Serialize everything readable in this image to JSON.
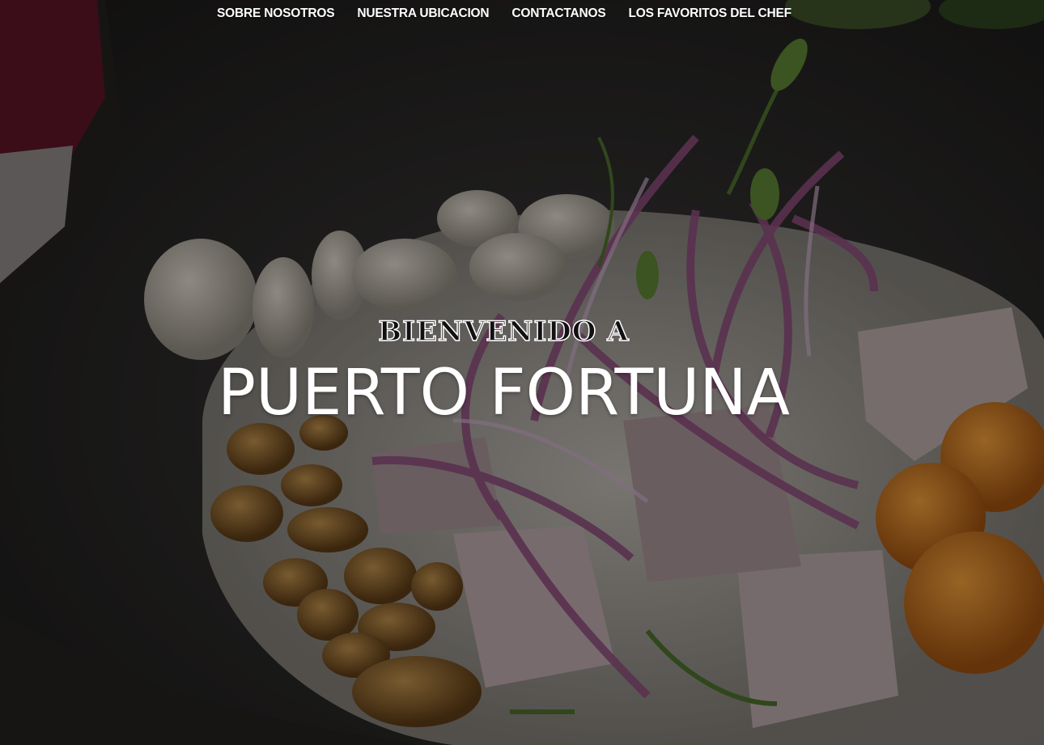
{
  "nav": {
    "items": [
      {
        "label": "SOBRE NOSOTROS"
      },
      {
        "label": "NUESTRA UBICACION"
      },
      {
        "label": "CONTACTANOS"
      },
      {
        "label": "LOS FAVORITOS DEL CHEF"
      }
    ]
  },
  "hero": {
    "kicker": "BIENVENIDO A",
    "title": "PUERTO FORTUNA",
    "image_subject": "ceviche-dish",
    "overlay_color": "#000000"
  },
  "colors": {
    "nav_text": "#ffffff",
    "title_text": "#ffffff"
  }
}
